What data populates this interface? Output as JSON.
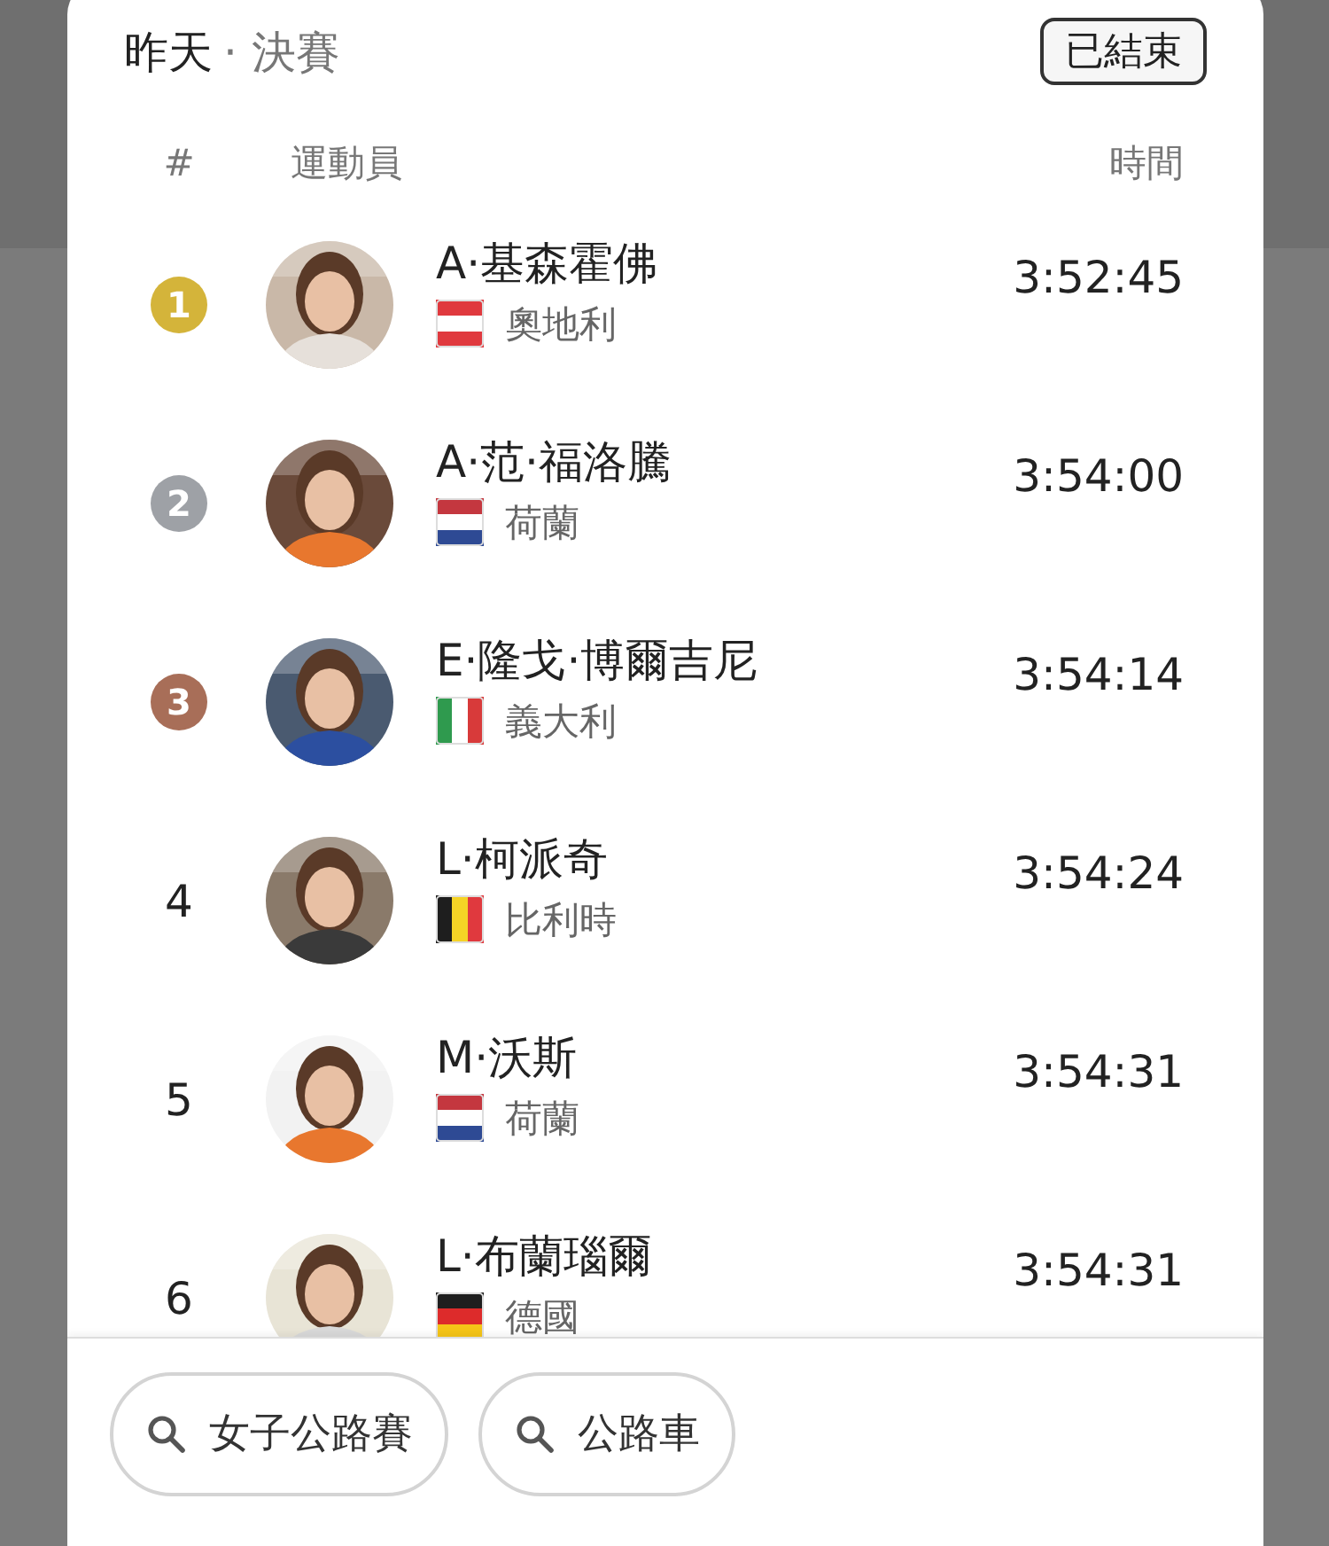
{
  "header": {
    "day": "昨天",
    "round": "· 決賽",
    "status": "已結束"
  },
  "columns": {
    "rank": "#",
    "athlete": "運動員",
    "time": "時間"
  },
  "rows": [
    {
      "rank": "1",
      "kind": "medal",
      "color": "#d4b43a",
      "name": "A·基森霍佛",
      "country": "奧地利",
      "flag": {
        "kind": "horizontal",
        "stripes": [
          {
            "color": "#e0393e"
          },
          {
            "color": "#ffffff"
          },
          {
            "color": "#e0393e"
          }
        ]
      },
      "time": "3:52:45"
    },
    {
      "rank": "2",
      "kind": "medal",
      "color": "#9ea1a6",
      "name": "A·范·福洛騰",
      "country": "荷蘭",
      "flag": {
        "kind": "horizontal",
        "stripes": [
          {
            "color": "#c4373f"
          },
          {
            "color": "#ffffff"
          },
          {
            "color": "#2e4a94"
          }
        ]
      },
      "time": "3:54:00"
    },
    {
      "rank": "3",
      "kind": "medal",
      "color": "#a86e58",
      "name": "E·隆戈·博爾吉尼",
      "country": "義大利",
      "flag": {
        "kind": "vertical",
        "stripes": [
          {
            "color": "#2f9a4e"
          },
          {
            "color": "#ffffff"
          },
          {
            "color": "#d83a3a"
          }
        ]
      },
      "time": "3:54:14"
    },
    {
      "rank": "4",
      "kind": "plain",
      "name": "L·柯派奇",
      "country": "比利時",
      "flag": {
        "kind": "vertical",
        "stripes": [
          {
            "color": "#1e1e1e"
          },
          {
            "color": "#f5d326"
          },
          {
            "color": "#e0393e"
          }
        ]
      },
      "time": "3:54:24"
    },
    {
      "rank": "5",
      "kind": "plain",
      "name": "M·沃斯",
      "country": "荷蘭",
      "flag": {
        "kind": "horizontal",
        "stripes": [
          {
            "color": "#c4373f"
          },
          {
            "color": "#ffffff"
          },
          {
            "color": "#2e4a94"
          }
        ]
      },
      "time": "3:54:31"
    },
    {
      "rank": "6",
      "kind": "plain",
      "name": "L·布蘭瑙爾",
      "country": "德國",
      "flag": {
        "kind": "horizontal",
        "stripes": [
          {
            "color": "#1e1e1e"
          },
          {
            "color": "#dd2b2b"
          },
          {
            "color": "#f5c518"
          }
        ]
      },
      "time": "3:54:31"
    }
  ],
  "searches": [
    "女子公路賽",
    "公路車"
  ]
}
